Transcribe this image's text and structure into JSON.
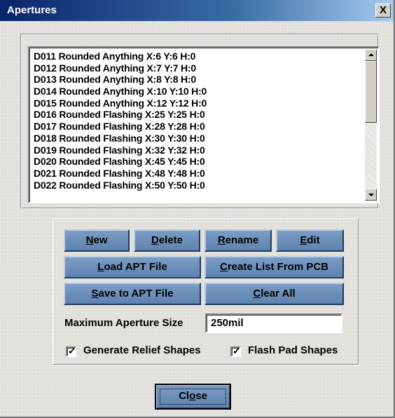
{
  "window": {
    "title": "Apertures",
    "close_glyph": "X"
  },
  "aperture_list": {
    "items": [
      "D011 Rounded Anything X:6 Y:6 H:0",
      "D012 Rounded Anything X:7 Y:7 H:0",
      "D013 Rounded Anything X:8 Y:8 H:0",
      "D014 Rounded Anything X:10 Y:10 H:0",
      "D015 Rounded Anything X:12 Y:12 H:0",
      "D016 Rounded Flashing X:25 Y:25 H:0",
      "D017 Rounded Flashing X:28 Y:28 H:0",
      "D018 Rounded Flashing X:30 Y:30 H:0",
      "D019 Rounded Flashing X:32 Y:32 H:0",
      "D020 Rounded Flashing X:45 Y:45 H:0",
      "D021 Rounded Flashing X:48 Y:48 H:0",
      "D022 Rounded Flashing X:50 Y:50 H:0"
    ]
  },
  "buttons": {
    "new": {
      "accel": "N",
      "rest": "ew"
    },
    "delete": {
      "accel": "D",
      "rest": "elete"
    },
    "rename": {
      "accel": "R",
      "rest": "ename"
    },
    "edit": {
      "accel": "E",
      "rest": "dit"
    },
    "load_apt": {
      "accel": "L",
      "rest": "oad APT File"
    },
    "create_list": {
      "accel": "C",
      "rest": "reate List From PCB"
    },
    "save_apt": {
      "accel": "S",
      "rest": "ave to APT File"
    },
    "clear_all": {
      "pre": "",
      "accel": "C",
      "rest": "lear All"
    },
    "close": {
      "pre": "Cl",
      "accel": "o",
      "rest": "se"
    }
  },
  "max_aperture": {
    "label": "Maximum Aperture Size",
    "value": "250mil"
  },
  "checkboxes": {
    "relief": {
      "label": "Generate Relief Shapes",
      "checked": true,
      "mark": "✓"
    },
    "flash": {
      "label": "Flash Pad Shapes",
      "checked": true,
      "mark": "✓"
    }
  },
  "colors": {
    "title_gradient_start": "#0a246a",
    "button_blue": "#6a8cb6",
    "dialog_gray": "#d4d0c8"
  }
}
